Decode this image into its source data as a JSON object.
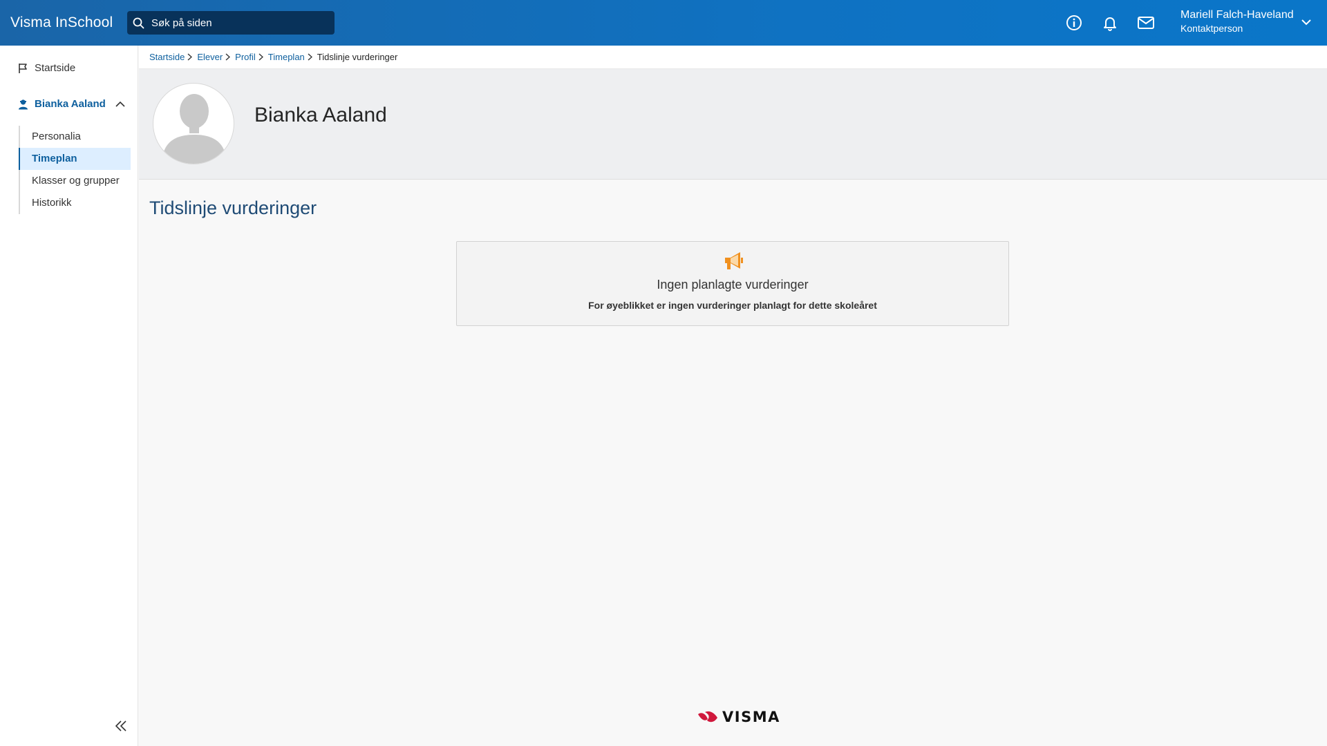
{
  "header": {
    "brand": "Visma InSchool",
    "search_placeholder": "Søk på siden",
    "icons": [
      "info-icon",
      "bell-icon",
      "mail-icon"
    ],
    "user": {
      "name": "Mariell Falch-Haveland",
      "role": "Kontaktperson"
    },
    "colors": {
      "bar": "#0f72c2",
      "search_bg": "#08325a"
    }
  },
  "sidebar": {
    "home_label": "Startside",
    "student_label": "Bianka Aaland",
    "items": [
      {
        "label": "Personalia",
        "active": false
      },
      {
        "label": "Timeplan",
        "active": true
      },
      {
        "label": "Klasser og grupper",
        "active": false
      },
      {
        "label": "Historikk",
        "active": false
      }
    ]
  },
  "breadcrumb": {
    "links": [
      "Startside",
      "Elever",
      "Profil",
      "Timeplan"
    ],
    "current": "Tidslinje vurderinger"
  },
  "profile": {
    "name": "Bianka Aaland"
  },
  "main": {
    "title": "Tidslinje vurderinger",
    "empty_state": {
      "icon": "megaphone-icon",
      "title": "Ingen planlagte vurderinger",
      "subtitle": "For øyeblikket er ingen vurderinger planlagt for dette skoleåret",
      "icon_color": "#f0901e"
    }
  },
  "footer": {
    "logo_text": "VISMA",
    "logo_color": "#d0183c"
  }
}
